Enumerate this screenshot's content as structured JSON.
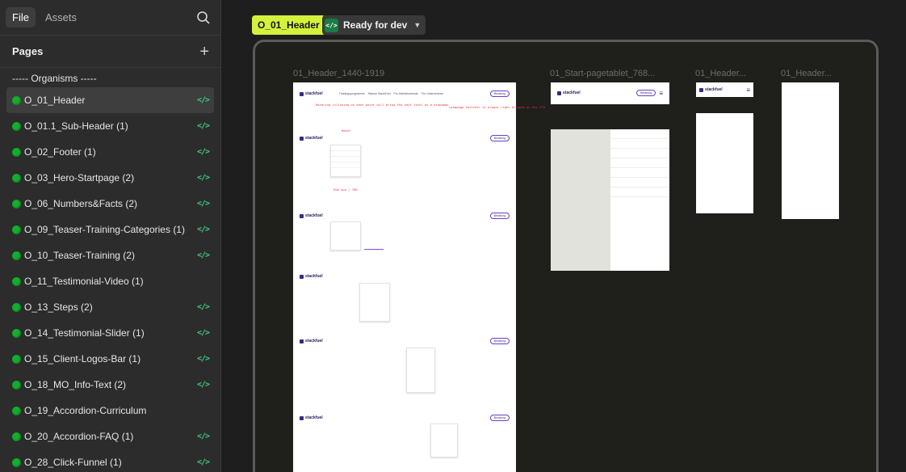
{
  "sidebar": {
    "tabs": {
      "file": "File",
      "assets": "Assets"
    },
    "pages_title": "Pages",
    "items": [
      {
        "label": "----- Organisms -----",
        "dot": false,
        "dev": false
      },
      {
        "label": "O_01_Header",
        "dot": true,
        "dev": true,
        "selected": true
      },
      {
        "label": " O_01.1_Sub-Header (1)",
        "dot": true,
        "dev": true
      },
      {
        "label": "O_02_Footer (1)",
        "dot": true,
        "dev": true
      },
      {
        "label": "O_03_Hero-Startpage (2)",
        "dot": true,
        "dev": true
      },
      {
        "label": "O_06_Numbers&Facts (2)",
        "dot": true,
        "dev": true
      },
      {
        "label": "O_09_Teaser-Training-Categories (1)",
        "dot": true,
        "dev": true
      },
      {
        "label": "O_10_Teaser-Training (2)",
        "dot": true,
        "dev": true
      },
      {
        "label": "O_11_Testimonial-Video (1)",
        "dot": true,
        "dev": false
      },
      {
        "label": "O_13_Steps (2)",
        "dot": true,
        "dev": true
      },
      {
        "label": "O_14_Testimonial-Slider (1)",
        "dot": true,
        "dev": true
      },
      {
        "label": "O_15_Client-Logos-Bar (1)",
        "dot": true,
        "dev": true
      },
      {
        "label": "O_18_MO_Info-Text (2)",
        "dot": true,
        "dev": true
      },
      {
        "label": "O_19_Accordion-Curriculum",
        "dot": true,
        "dev": false
      },
      {
        "label": "O_20_Accordion-FAQ (1)",
        "dot": true,
        "dev": true
      },
      {
        "label": "O_28_Click-Funnel (1)",
        "dot": true,
        "dev": true
      }
    ],
    "dev_glyph": "</>"
  },
  "canvas": {
    "header_chip": "O_01_Header",
    "status_chip": "Ready for dev",
    "status_icon_glyph": "</>",
    "frames": {
      "desktop": "01_Header_1440-1919",
      "tablet": "01_Start-pagetablet_768...",
      "mobile1": "01_Header...",
      "mobile2": "01_Header..."
    },
    "mini": {
      "logo": "stackfuel",
      "nav": [
        "Trainingsprogramme",
        "Warum StackFuel",
        "Für Arbeitsuchende",
        "Für Unternehmen",
        "Ressourcen",
        "Über uns"
      ],
      "cta": "Beratung",
      "note_hover": "Hovering /clicking on each point will bring the next level as a dropdown",
      "note_lang": "Language Switcher is always right-aligned on the CTA",
      "note_hover_tag": "Hover",
      "note_pad": "Pad 4px / 700"
    }
  },
  "colors": {
    "accent_green": "#d4f23c",
    "status_green": "#1a7c45",
    "dot_green": "#14ae2f",
    "brand_purple": "#6a3ec9"
  }
}
